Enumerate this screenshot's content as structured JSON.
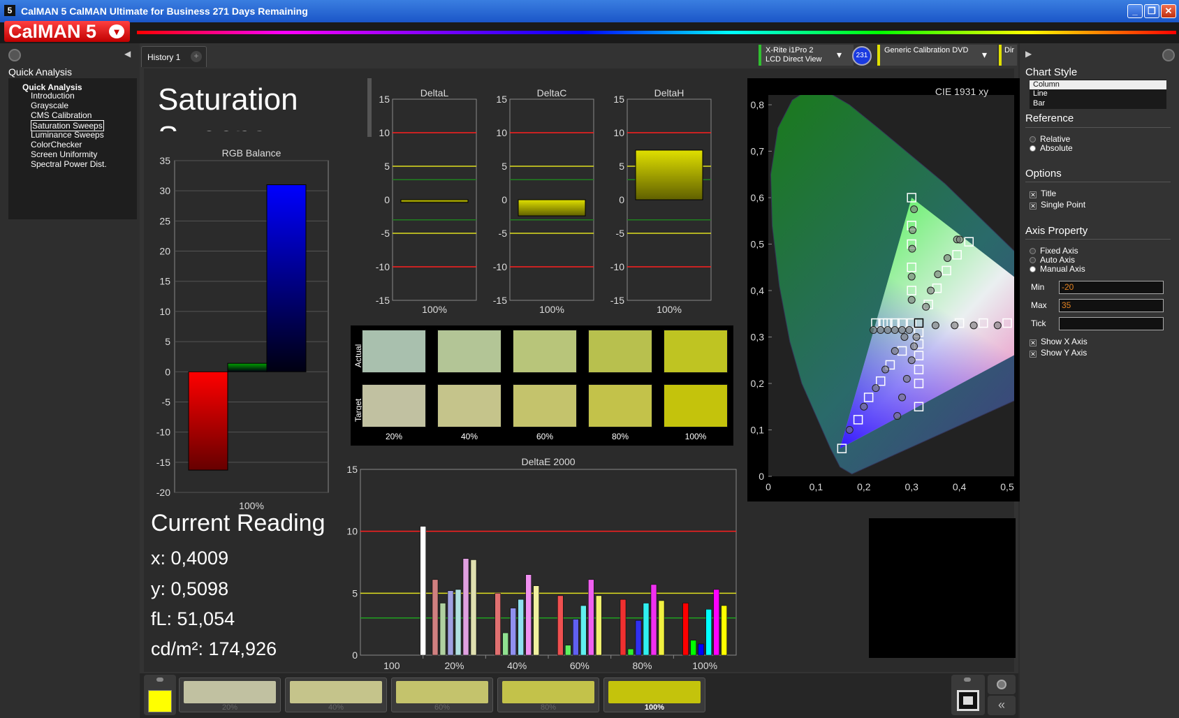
{
  "window": {
    "title": "CalMAN 5 CalMAN Ultimate for Business 271 Days Remaining",
    "minimize": "_",
    "restore": "❐",
    "close": "✕"
  },
  "brand": {
    "logo": "CalMAN 5",
    "menu_arrow": "▾"
  },
  "left_panel": {
    "heading": "Quick Analysis",
    "tree_root": "Quick Analysis",
    "items": [
      "Introduction",
      "Grayscale",
      "CMS Calibration",
      "Saturation Sweeps",
      "Luminance Sweeps",
      "ColorChecker",
      "Screen Uniformity",
      "Spectral Power Dist."
    ],
    "selected_index": 3
  },
  "tabs": {
    "history_tab": "History 1",
    "add_tab": "+"
  },
  "devices": {
    "meter_line1": "X-Rite i1Pro 2",
    "meter_line2": "LCD Direct View",
    "badge": "231",
    "source": "Generic Calibration DVD",
    "cut": "Dir"
  },
  "page": {
    "title_line1": "Saturation",
    "title_line2": "Sweeps"
  },
  "rgb_balance": {
    "title": "RGB Balance",
    "ticks": [
      "35",
      "30",
      "25",
      "20",
      "15",
      "10",
      "5",
      "0",
      "-5",
      "-10",
      "-15",
      "-20"
    ],
    "xlabel": "100%"
  },
  "delta_charts": {
    "ticks": [
      "15",
      "10",
      "5",
      "0",
      "-5",
      "-10",
      "-15"
    ],
    "items": [
      {
        "title": "DeltaL",
        "xlabel": "100%"
      },
      {
        "title": "DeltaC",
        "xlabel": "100%"
      },
      {
        "title": "DeltaH",
        "xlabel": "100%"
      }
    ]
  },
  "swatches": {
    "row_actual": "Actual",
    "row_target": "Target",
    "labels": [
      "20%",
      "40%",
      "60%",
      "80%",
      "100%"
    ],
    "actual_colors": [
      "#a9c0ae",
      "#b3c596",
      "#b8c57a",
      "#b8c04e",
      "#bfc422"
    ],
    "target_colors": [
      "#c1c1a1",
      "#c5c48b",
      "#c4c36c",
      "#c3c24a",
      "#c4c30c"
    ]
  },
  "deltae": {
    "title": "DeltaE 2000",
    "ticks": [
      "15",
      "10",
      "5",
      "0"
    ],
    "xlabels": [
      "100",
      "20%",
      "40%",
      "60%",
      "80%",
      "100%"
    ]
  },
  "cie": {
    "title": "CIE 1931 xy",
    "yticks": [
      "0,8",
      "0,7",
      "0,6",
      "0,5",
      "0,4",
      "0,3",
      "0,2",
      "0,1",
      "0"
    ],
    "xticks": [
      "0",
      "0,1",
      "0,2",
      "0,3",
      "0,4",
      "0,5"
    ]
  },
  "reading": {
    "heading": "Current Reading",
    "x": "x: 0,4009",
    "y": "y: 0,5098",
    "fl": "fL: 51,054",
    "cdm2": "cd/m²: 174,926"
  },
  "bottom": {
    "swatch_labels": [
      "20%",
      "40%",
      "60%",
      "80%",
      "100%"
    ],
    "current_color": "#ffff00",
    "swatch_colors": [
      "#c1c1a1",
      "#c5c48b",
      "#c4c36c",
      "#c3c24a",
      "#c4c30c"
    ]
  },
  "right_panel": {
    "chart_style_heading": "Chart Style",
    "chart_styles": [
      "Column",
      "Line",
      "Bar"
    ],
    "reference_heading": "Reference",
    "reference_options": [
      "Relative",
      "Absolute"
    ],
    "options_heading": "Options",
    "option_title": "Title",
    "option_single_point": "Single Point",
    "axis_heading": "Axis Property",
    "axis_options": [
      "Fixed Axis",
      "Auto Axis",
      "Manual Axis"
    ],
    "min_label": "Min",
    "min_value": "-20",
    "max_label": "Max",
    "max_value": "35",
    "tick_label": "Tick",
    "tick_value": "",
    "show_x": "Show X Axis",
    "show_y": "Show Y Axis"
  },
  "chart_data": [
    {
      "type": "bar",
      "title": "RGB Balance",
      "categories": [
        "100%"
      ],
      "series": [
        {
          "name": "R",
          "values": [
            -16.3
          ],
          "color": "#ff0000"
        },
        {
          "name": "G",
          "values": [
            1.4
          ],
          "color": "#00a000"
        },
        {
          "name": "B",
          "values": [
            31
          ],
          "color": "#0000ff"
        }
      ],
      "ylim": [
        -20,
        35
      ]
    },
    {
      "type": "bar",
      "title": "DeltaL",
      "categories": [
        "100%"
      ],
      "values": [
        -0.4
      ],
      "ylim": [
        -15,
        15
      ]
    },
    {
      "type": "bar",
      "title": "DeltaC",
      "categories": [
        "100%"
      ],
      "values": [
        -2.4
      ],
      "ylim": [
        -15,
        15
      ]
    },
    {
      "type": "bar",
      "title": "DeltaH",
      "categories": [
        "100%"
      ],
      "values": [
        7.4
      ],
      "ylim": [
        -15,
        15
      ]
    },
    {
      "type": "bar",
      "title": "DeltaE 2000",
      "categories": [
        "100",
        "20%",
        "40%",
        "60%",
        "80%",
        "100%"
      ],
      "groups": [
        [
          {
            "v": 10.4,
            "c": "#ffffff"
          }
        ],
        [
          {
            "v": 6.1,
            "c": "#d08080"
          },
          {
            "v": 4.2,
            "c": "#b0d0a0"
          },
          {
            "v": 5.2,
            "c": "#a0a0e0"
          },
          {
            "v": 5.3,
            "c": "#b0e0e0"
          },
          {
            "v": 7.8,
            "c": "#e0a0e0"
          },
          {
            "v": 7.7,
            "c": "#e0e0b0"
          }
        ],
        [
          {
            "v": 5.0,
            "c": "#e07070"
          },
          {
            "v": 1.8,
            "c": "#90e090"
          },
          {
            "v": 3.8,
            "c": "#9090f0"
          },
          {
            "v": 4.5,
            "c": "#90e0f0"
          },
          {
            "v": 6.5,
            "c": "#f090f0"
          },
          {
            "v": 5.6,
            "c": "#f0f0a0"
          }
        ],
        [
          {
            "v": 4.8,
            "c": "#f05050"
          },
          {
            "v": 0.8,
            "c": "#60f060"
          },
          {
            "v": 2.9,
            "c": "#6060f0"
          },
          {
            "v": 4.0,
            "c": "#60f0f0"
          },
          {
            "v": 6.1,
            "c": "#f060f0"
          },
          {
            "v": 4.8,
            "c": "#f0f070"
          }
        ],
        [
          {
            "v": 4.5,
            "c": "#f03030"
          },
          {
            "v": 0.5,
            "c": "#30f030"
          },
          {
            "v": 2.8,
            "c": "#3030f0"
          },
          {
            "v": 4.2,
            "c": "#30f0f0"
          },
          {
            "v": 5.7,
            "c": "#f030f0"
          },
          {
            "v": 4.4,
            "c": "#f0f040"
          }
        ],
        [
          {
            "v": 4.2,
            "c": "#ff0000"
          },
          {
            "v": 1.2,
            "c": "#00ff00"
          },
          {
            "v": 0.9,
            "c": "#0000ff"
          },
          {
            "v": 3.7,
            "c": "#00ffff"
          },
          {
            "v": 5.3,
            "c": "#ff00ff"
          },
          {
            "v": 4.0,
            "c": "#ffff00"
          }
        ]
      ],
      "ylim": [
        0,
        15
      ],
      "reference_lines": [
        {
          "v": 10,
          "c": "#ff2020"
        },
        {
          "v": 5,
          "c": "#e0e020"
        },
        {
          "v": 3,
          "c": "#20a020"
        }
      ]
    },
    {
      "type": "scatter",
      "title": "CIE 1931 xy",
      "xlim": [
        0,
        0.5
      ],
      "ylim": [
        0,
        0.8
      ],
      "gamut": [
        [
          0.64,
          0.33
        ],
        [
          0.3,
          0.6
        ],
        [
          0.15,
          0.06
        ]
      ],
      "white": [
        0.3127,
        0.329
      ],
      "targets": [
        [
          0.3,
          0.6
        ],
        [
          0.3,
          0.54
        ],
        [
          0.3,
          0.5
        ],
        [
          0.3,
          0.45
        ],
        [
          0.3,
          0.4
        ],
        [
          0.42,
          0.505
        ],
        [
          0.395,
          0.477
        ],
        [
          0.373,
          0.443
        ],
        [
          0.353,
          0.405
        ],
        [
          0.335,
          0.37
        ],
        [
          0.56,
          0.33
        ],
        [
          0.5,
          0.33
        ],
        [
          0.45,
          0.33
        ],
        [
          0.4,
          0.33
        ],
        [
          0.154,
          0.06
        ],
        [
          0.188,
          0.122
        ],
        [
          0.21,
          0.17
        ],
        [
          0.235,
          0.205
        ],
        [
          0.255,
          0.24
        ],
        [
          0.28,
          0.27
        ],
        [
          0.225,
          0.33
        ],
        [
          0.24,
          0.33
        ],
        [
          0.25,
          0.33
        ],
        [
          0.265,
          0.33
        ],
        [
          0.28,
          0.33
        ],
        [
          0.3,
          0.33
        ],
        [
          0.315,
          0.15
        ],
        [
          0.315,
          0.2
        ],
        [
          0.315,
          0.23
        ],
        [
          0.315,
          0.26
        ],
        [
          0.315,
          0.285
        ],
        [
          0.315,
          0.31
        ],
        [
          0.315,
          0.33
        ]
      ],
      "measured": [
        [
          0.305,
          0.575
        ],
        [
          0.302,
          0.53
        ],
        [
          0.301,
          0.49
        ],
        [
          0.3,
          0.43
        ],
        [
          0.3,
          0.38
        ],
        [
          0.395,
          0.51
        ],
        [
          0.375,
          0.47
        ],
        [
          0.355,
          0.435
        ],
        [
          0.34,
          0.4
        ],
        [
          0.33,
          0.365
        ],
        [
          0.48,
          0.325
        ],
        [
          0.43,
          0.325
        ],
        [
          0.39,
          0.325
        ],
        [
          0.35,
          0.325
        ],
        [
          0.17,
          0.1
        ],
        [
          0.2,
          0.15
        ],
        [
          0.225,
          0.19
        ],
        [
          0.245,
          0.23
        ],
        [
          0.265,
          0.27
        ],
        [
          0.285,
          0.3
        ],
        [
          0.22,
          0.315
        ],
        [
          0.235,
          0.315
        ],
        [
          0.25,
          0.315
        ],
        [
          0.265,
          0.315
        ],
        [
          0.28,
          0.315
        ],
        [
          0.295,
          0.315
        ],
        [
          0.27,
          0.13
        ],
        [
          0.28,
          0.17
        ],
        [
          0.29,
          0.21
        ],
        [
          0.3,
          0.25
        ],
        [
          0.305,
          0.28
        ],
        [
          0.31,
          0.3
        ],
        [
          0.4009,
          0.5098
        ]
      ]
    }
  ]
}
